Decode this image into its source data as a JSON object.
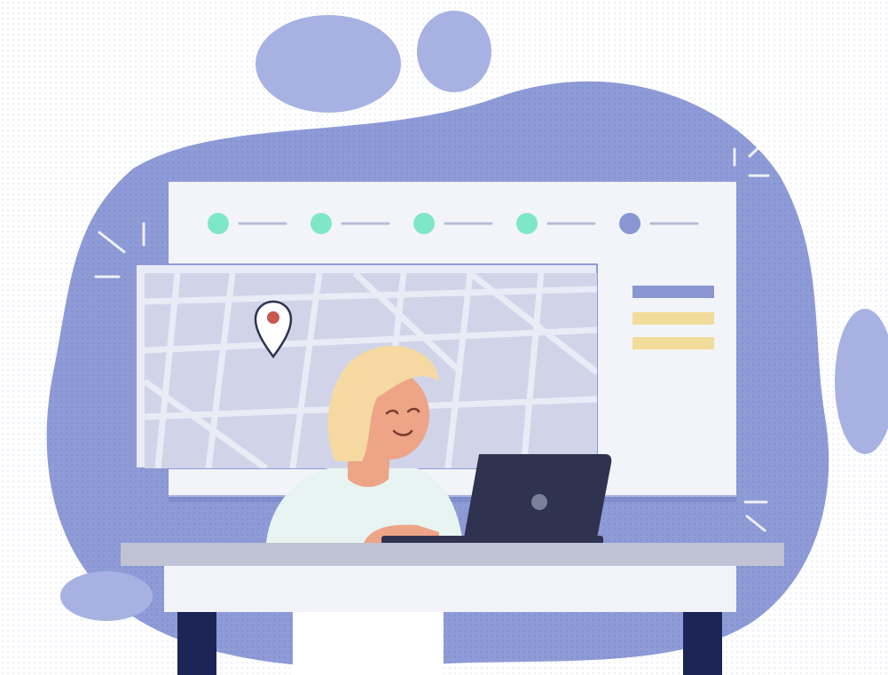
{
  "illustration": {
    "subject": "woman-at-laptop-with-location-map",
    "colors": {
      "blob": "#8e9bd6",
      "blob_dark": "#7d8ccd",
      "blob_light": "#a7b2e2",
      "screen_bg": "#f3f4fa",
      "map_bg": "#c9cde6",
      "map_streets": "#e6e8f4",
      "step_done": "#7ee7c6",
      "step_current": "#8a96d2",
      "step_line": "#b6bcd6",
      "sidebar_bar_primary": "#8a96d2",
      "sidebar_bar_secondary": "#f2dc9b",
      "hair": "#f5d9a0",
      "skin": "#eea486",
      "shirt": "#e7f4f2",
      "laptop": "#2f3350",
      "desk_top": "#bfc3d4",
      "desk_front": "#f2f3f8",
      "desk_legs": "#1c2556",
      "pin": "#c9574f"
    },
    "progress_steps": [
      {
        "status": "done"
      },
      {
        "status": "done"
      },
      {
        "status": "done"
      },
      {
        "status": "done"
      },
      {
        "status": "current"
      }
    ],
    "icons": [
      "location-pin-icon",
      "laptop-logo-icon",
      "sparkle-icon"
    ]
  }
}
